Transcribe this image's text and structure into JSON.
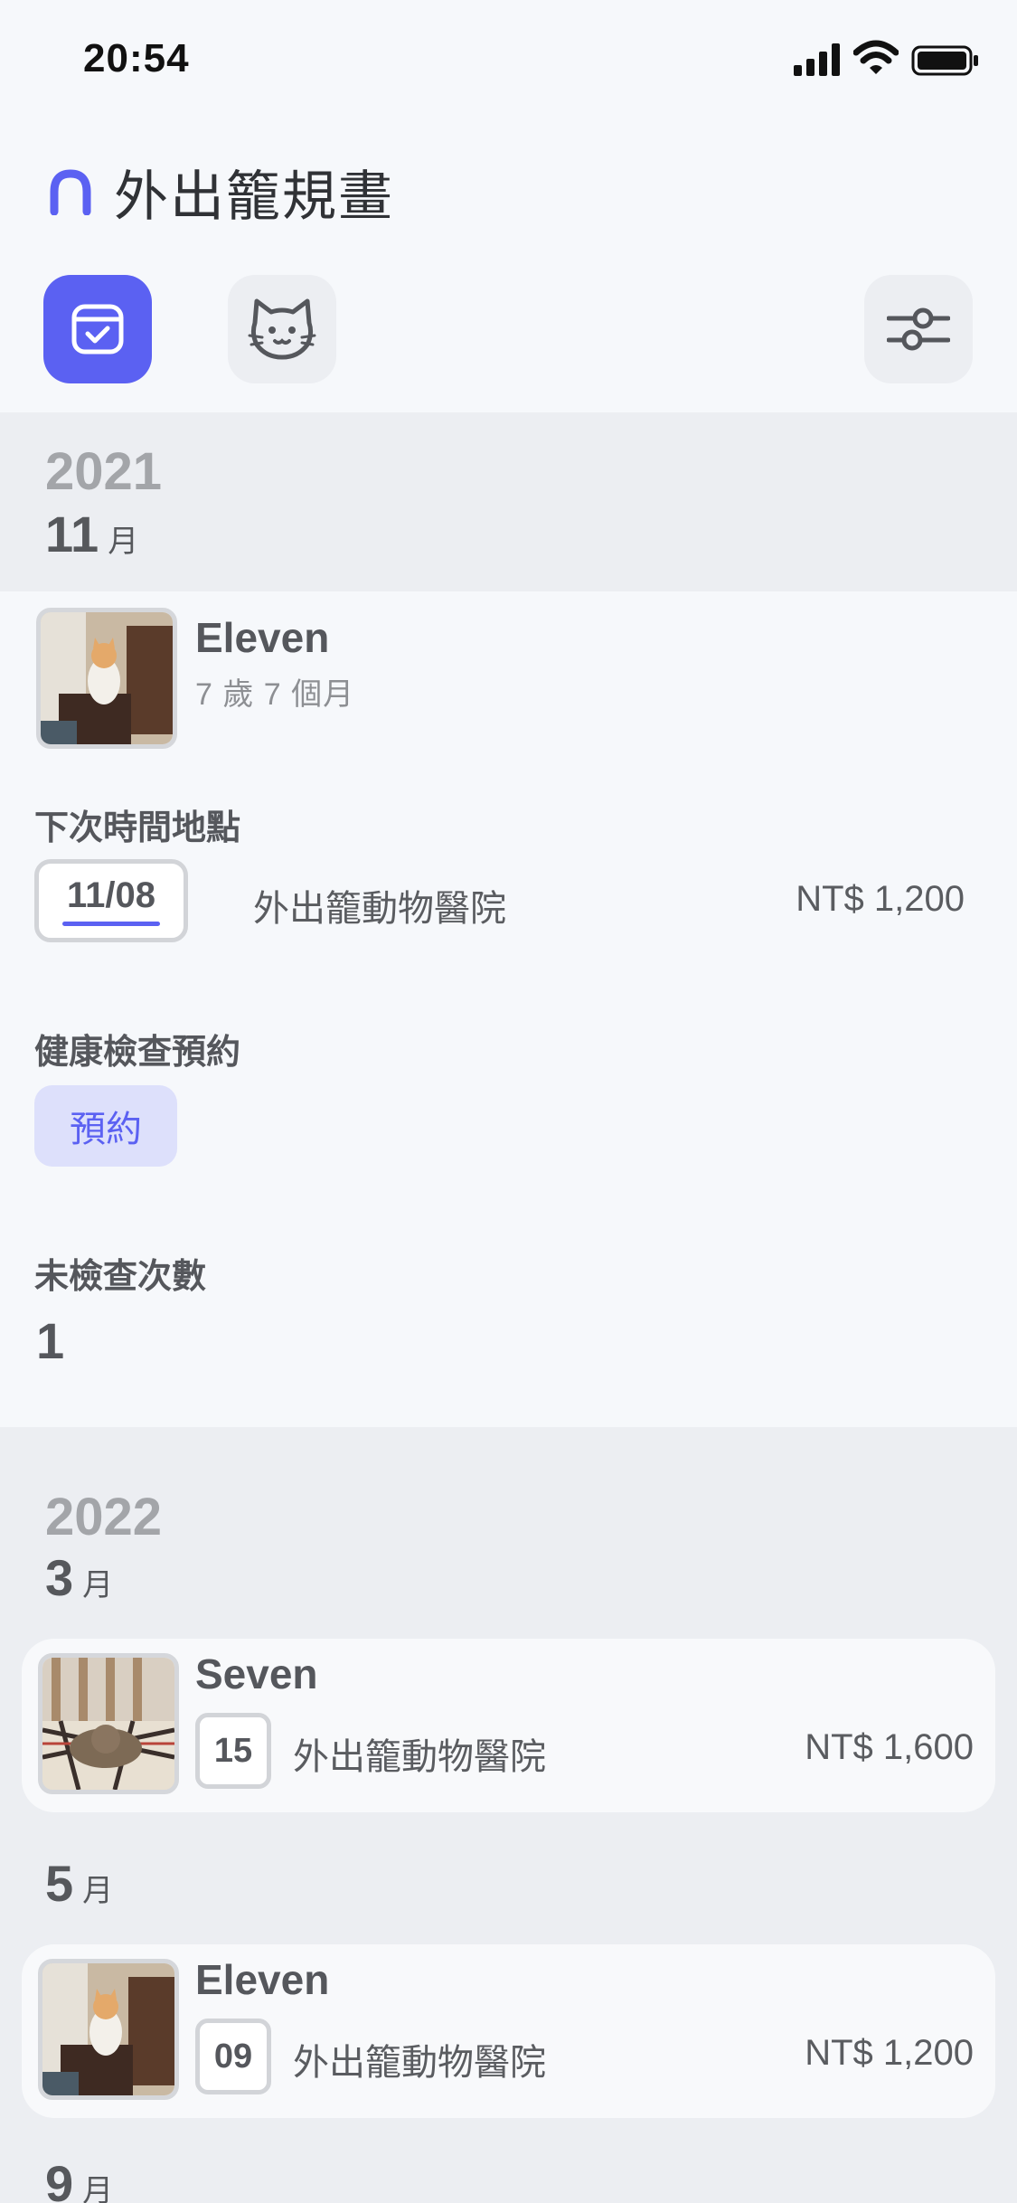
{
  "status_bar": {
    "time": "20:54"
  },
  "header": {
    "title": "外出籠規畫"
  },
  "toolbar": {
    "calendar_icon": "calendar-check-icon",
    "cat_icon": "cat-icon",
    "filter_icon": "sliders-icon"
  },
  "colors": {
    "accent": "#5b61f2",
    "accent_light": "#dde0fb",
    "group_bg": "#eceef2",
    "page_bg": "#f6f8fb"
  },
  "groups": [
    {
      "year": "2021",
      "month": "11",
      "month_unit": "月",
      "expanded_item": {
        "cat_name": "Eleven",
        "cat_age": "7 歲 7 個月",
        "next_label": "下次時間地點",
        "date": "11/08",
        "place": "外出籠動物醫院",
        "price": "NT$ 1,200",
        "health_label": "健康檢查預約",
        "reserve_label": "預約",
        "unchecked_label": "未檢查次數",
        "unchecked_count": "1"
      }
    },
    {
      "year": "2022",
      "months": [
        {
          "month": "3",
          "month_unit": "月",
          "item": {
            "cat_name": "Seven",
            "day": "15",
            "place": "外出籠動物醫院",
            "price": "NT$ 1,600"
          }
        },
        {
          "month": "5",
          "month_unit": "月",
          "item": {
            "cat_name": "Eleven",
            "day": "09",
            "place": "外出籠動物醫院",
            "price": "NT$ 1,200"
          }
        },
        {
          "month": "9",
          "month_unit": "月"
        }
      ]
    }
  ]
}
